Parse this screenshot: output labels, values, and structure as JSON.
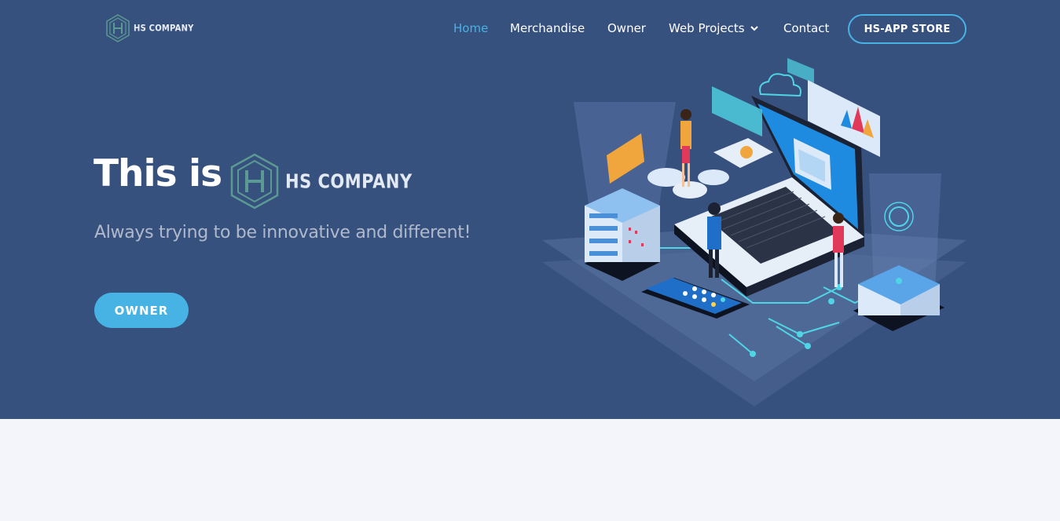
{
  "header": {
    "logo_text": "HS COMPANY",
    "nav": [
      {
        "label": "Home",
        "active": true
      },
      {
        "label": "Merchandise",
        "active": false
      },
      {
        "label": "Owner",
        "active": false
      },
      {
        "label": "Web Projects",
        "active": false,
        "icon": "chevron-down-icon"
      },
      {
        "label": "Contact",
        "active": false
      }
    ],
    "cta_label": "HS-APP STORE"
  },
  "hero": {
    "headline": "This is",
    "logo_text": "HS COMPANY",
    "subtitle": "Always trying to be innovative and different!",
    "button_label": "OWNER"
  },
  "colors": {
    "hero_bg": "#37517e",
    "accent": "#47b2e4",
    "page_bg": "#f3f5fa"
  }
}
